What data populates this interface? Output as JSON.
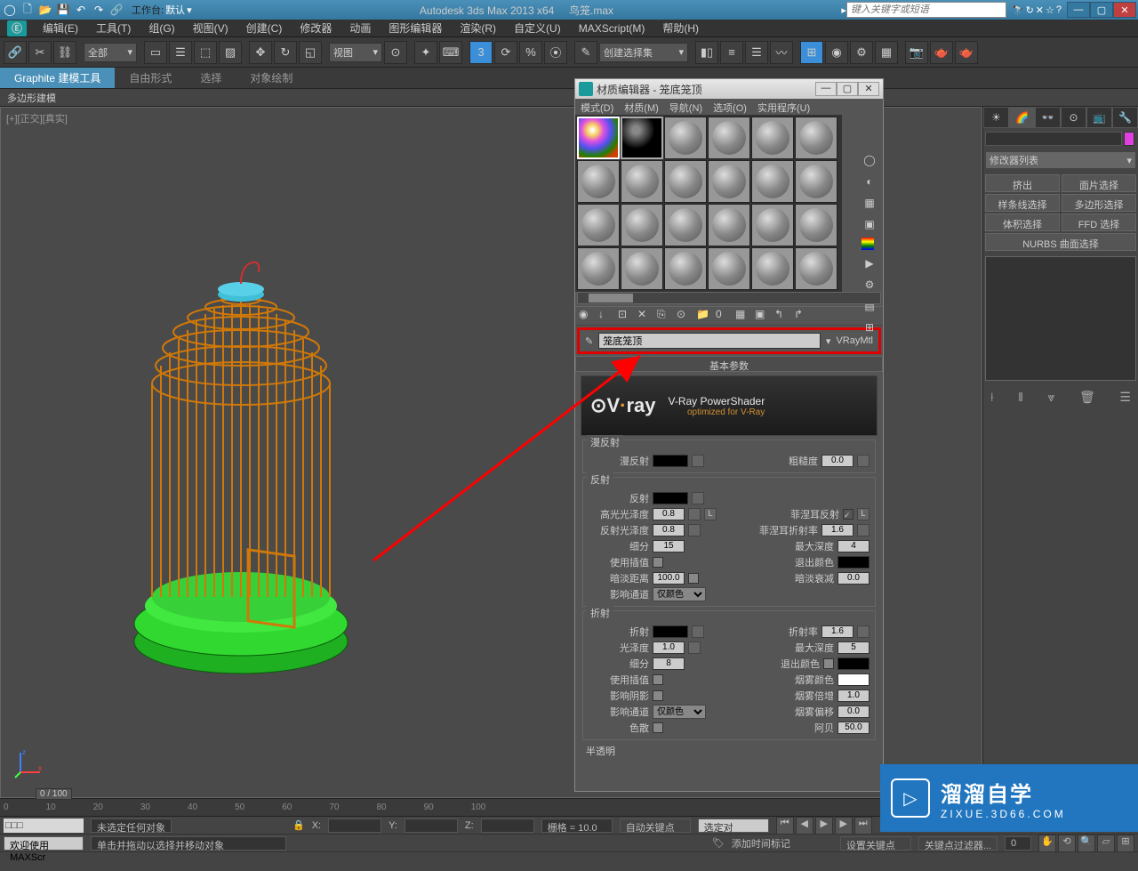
{
  "app": {
    "title": "Autodesk 3ds Max  2013 x64",
    "filename": "鸟笼.max",
    "search_placeholder": "键入关键字或短语",
    "workspace_label": "工作台:",
    "workspace_value": "默认"
  },
  "menus": [
    "编辑(E)",
    "工具(T)",
    "组(G)",
    "视图(V)",
    "创建(C)",
    "修改器",
    "动画",
    "图形编辑器",
    "渲染(R)",
    "自定义(U)",
    "MAXScript(M)",
    "帮助(H)"
  ],
  "ribbon": {
    "tabs": [
      "Graphite 建模工具",
      "自由形式",
      "选择",
      "对象绘制"
    ],
    "active": 0,
    "sub": "多边形建模"
  },
  "toolbar": {
    "selection_filter": "全部",
    "view_dropdown": "视图",
    "named_set": "创建选择集"
  },
  "viewport": {
    "label": "[+][正交][真实]"
  },
  "material_editor": {
    "title": "材质编辑器 - 笼底笼顶",
    "menus": [
      "模式(D)",
      "材质(M)",
      "导航(N)",
      "选项(O)",
      "实用程序(U)"
    ],
    "name_value": "笼底笼顶",
    "type_label": "VRayMtl",
    "rollup_basic": "基本参数",
    "vray_logo": "V·ray",
    "vray_title": "V-Ray PowerShader",
    "vray_sub": "optimized for V-Ray",
    "groups": {
      "diffuse": {
        "title": "漫反射",
        "diffuse_label": "漫反射",
        "roughness_label": "粗糙度",
        "roughness_value": "0.0"
      },
      "reflect": {
        "title": "反射",
        "reflect_label": "反射",
        "hglossy_label": "高光光泽度",
        "hglossy_value": "0.8",
        "rglossy_label": "反射光泽度",
        "rglossy_value": "0.8",
        "subdiv_label": "细分",
        "subdiv_value": "15",
        "use_interp_label": "使用插值",
        "dim_dist_label": "暗淡距离",
        "dim_dist_value": "100.0",
        "affect_chan_label": "影响通道",
        "affect_chan_value": "仅颜色",
        "fresnel_label": "菲涅耳反射",
        "fresnel_ior_label": "菲涅耳折射率",
        "fresnel_ior_value": "1.6",
        "max_depth_label": "最大深度",
        "max_depth_value": "4",
        "exit_color_label": "退出颜色",
        "dim_falloff_label": "暗淡衰减",
        "dim_falloff_value": "0.0",
        "L_button": "L"
      },
      "refract": {
        "title": "折射",
        "refract_label": "折射",
        "glossy_label": "光泽度",
        "glossy_value": "1.0",
        "subdiv_label": "细分",
        "subdiv_value": "8",
        "use_interp_label": "使用插值",
        "affect_shadow_label": "影响阴影",
        "affect_chan_label": "影响通道",
        "affect_chan_value": "仅颜色",
        "dispersion_label": "色散",
        "ior_label": "折射率",
        "ior_value": "1.6",
        "max_depth_label": "最大深度",
        "max_depth_value": "5",
        "exit_color_label": "退出颜色",
        "fog_color_label": "烟雾颜色",
        "fog_mult_label": "烟雾倍增",
        "fog_mult_value": "1.0",
        "fog_bias_label": "烟雾偏移",
        "fog_bias_value": "0.0",
        "abbe_label": "阿贝",
        "abbe_value": "50.0"
      },
      "translucency": {
        "title": "半透明"
      }
    }
  },
  "cmd_panel": {
    "modifier_list": "修改器列表",
    "buttons": [
      "挤出",
      "面片选择",
      "样条线选择",
      "多边形选择",
      "体积选择",
      "FFD 选择"
    ],
    "nurbs": "NURBS 曲面选择"
  },
  "timeline": {
    "frame": "0 / 100",
    "ticks": [
      "0",
      "10",
      "20",
      "30",
      "40",
      "50",
      "60",
      "70",
      "80",
      "90",
      "100"
    ]
  },
  "status": {
    "selection": "未选定任何对象",
    "hint": "单击并拖动以选择并移动对象",
    "welcome": "欢迎使用 MAXScr",
    "x": "X:",
    "y": "Y:",
    "z": "Z:",
    "grid": "栅格 = 10.0",
    "add_time_tag": "添加时间标记",
    "auto_key": "自动关键点",
    "set_key": "设置关键点",
    "selected_only": "选定对",
    "key_filters": "关键点过滤器..."
  },
  "watermark": {
    "big": "溜溜自学",
    "small": "ZIXUE.3D66.COM"
  }
}
